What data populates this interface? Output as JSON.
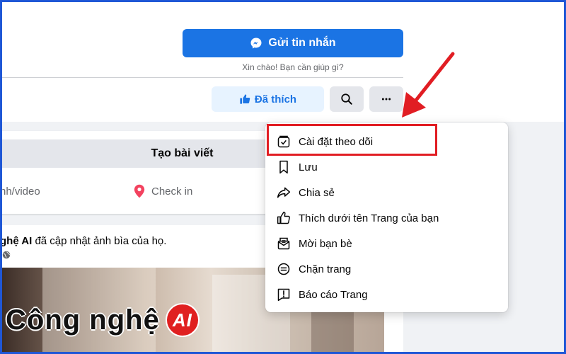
{
  "header": {
    "message_button": "Gửi tin nhắn",
    "greeting": "Xin chào! Bạn cần giúp gì?",
    "liked_button": "Đã thích"
  },
  "create_post": {
    "title": "Tạo bài viết",
    "photo_video": "nh/video",
    "check_in": "Check in"
  },
  "post": {
    "author": "ghệ AI",
    "action": " đã cập nhật ảnh bìa của họ.",
    "brand_text": "Công nghệ",
    "brand_badge": "AI"
  },
  "menu": {
    "items": [
      {
        "label": "Cài đặt theo dõi",
        "icon": "follow-settings-icon"
      },
      {
        "label": "Lưu",
        "icon": "bookmark-icon"
      },
      {
        "label": "Chia sẻ",
        "icon": "share-icon"
      },
      {
        "label": "Thích dưới tên Trang của bạn",
        "icon": "like-icon"
      },
      {
        "label": "Mời bạn bè",
        "icon": "invite-envelope-icon"
      },
      {
        "label": "Chặn trang",
        "icon": "block-icon"
      },
      {
        "label": "Báo cáo Trang",
        "icon": "report-icon"
      }
    ]
  },
  "colors": {
    "primary": "#1b74e4",
    "highlight": "#e11d23",
    "frame": "#1f57d6"
  }
}
